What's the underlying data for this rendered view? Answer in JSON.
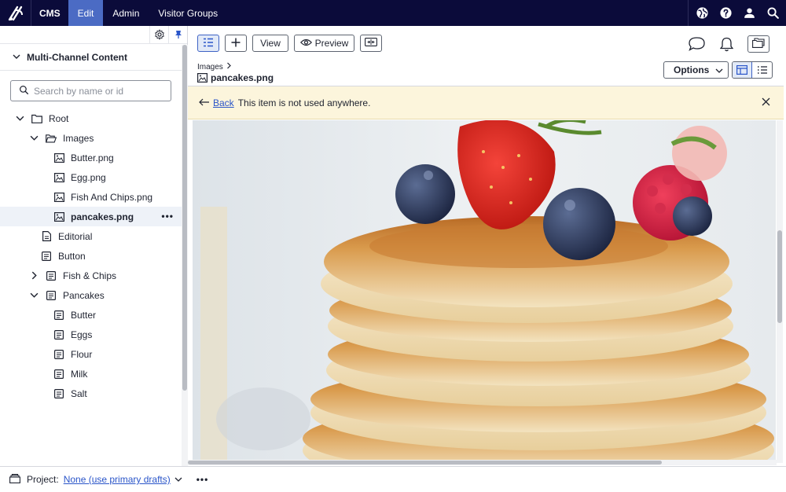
{
  "topnav": {
    "items": [
      {
        "label": "CMS"
      },
      {
        "label": "Edit"
      },
      {
        "label": "Admin"
      },
      {
        "label": "Visitor Groups"
      }
    ],
    "active": "Edit"
  },
  "sidebar": {
    "title": "Multi-Channel Content",
    "search_placeholder": "Search by name or id",
    "tree": [
      {
        "label": "Root",
        "icon": "folder-icon",
        "level": 0,
        "expanded": true
      },
      {
        "label": "Images",
        "icon": "folder-open-icon",
        "level": 1,
        "expanded": true
      },
      {
        "label": "Butter.png",
        "icon": "image-icon",
        "level": 2
      },
      {
        "label": "Egg.png",
        "icon": "image-icon",
        "level": 2
      },
      {
        "label": "Fish And Chips.png",
        "icon": "image-icon",
        "level": 2
      },
      {
        "label": "pancakes.png",
        "icon": "image-icon",
        "level": 2,
        "selected": true
      },
      {
        "label": "Editorial",
        "icon": "page-icon",
        "level": 1
      },
      {
        "label": "Button",
        "icon": "block-icon",
        "level": 1
      },
      {
        "label": "Fish & Chips",
        "icon": "block-icon",
        "level": 1,
        "expanded": false
      },
      {
        "label": "Pancakes",
        "icon": "block-icon",
        "level": 1,
        "expanded": true
      },
      {
        "label": "Butter",
        "icon": "block-icon",
        "level": 2
      },
      {
        "label": "Eggs",
        "icon": "block-icon",
        "level": 2
      },
      {
        "label": "Flour",
        "icon": "block-icon",
        "level": 2
      },
      {
        "label": "Milk",
        "icon": "block-icon",
        "level": 2
      },
      {
        "label": "Salt",
        "icon": "block-icon",
        "level": 2
      }
    ]
  },
  "toolbar": {
    "view_label": "View",
    "preview_label": "Preview"
  },
  "content": {
    "breadcrumb": "Images",
    "title": "pancakes.png",
    "options_label": "Options"
  },
  "notice": {
    "back_label": "Back",
    "message": "This item is not used anywhere."
  },
  "bottombar": {
    "project_label": "Project:",
    "project_value": "None (use primary drafts)"
  },
  "colors": {
    "topbar": "#0b0b3a",
    "active_nav": "#4b6bc4",
    "link": "#2a55c9",
    "notice_bg": "#fcf5dc"
  }
}
